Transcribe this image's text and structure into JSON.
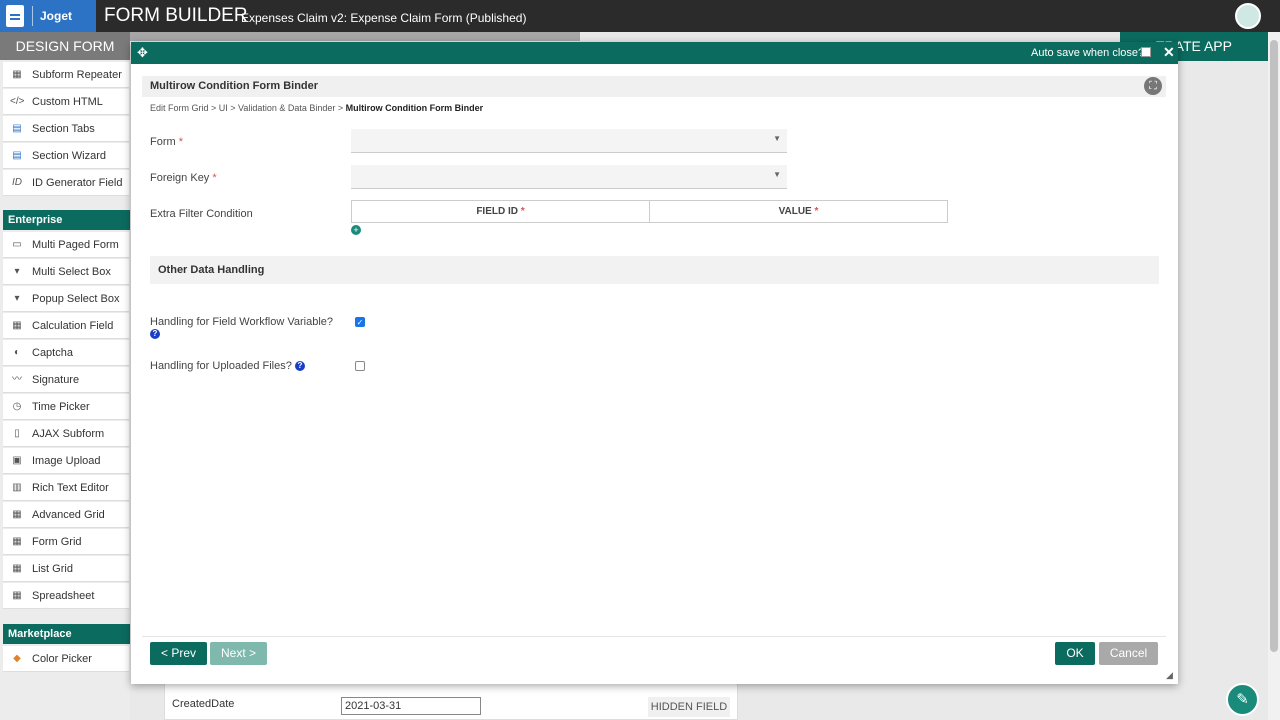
{
  "header": {
    "brand": "Joget",
    "title": "FORM BUILDER",
    "subtitle": "Expenses Claim v2: Expense Claim Form (Published)"
  },
  "tabs": {
    "design_form": "DESIGN FORM",
    "generate_app": "TRATE APP"
  },
  "sidebar": {
    "items_top": [
      {
        "label": "Subform Repeater",
        "icon": "grid-icon"
      },
      {
        "label": "Custom HTML",
        "icon": "code-icon"
      },
      {
        "label": "Section Tabs",
        "icon": "tabs-icon"
      },
      {
        "label": "Section Wizard",
        "icon": "wizard-icon"
      },
      {
        "label": "ID Generator Field",
        "icon": "id-icon"
      }
    ],
    "section_enterprise": "Enterprise",
    "items_enterprise": [
      {
        "label": "Multi Paged Form",
        "icon": "form-icon"
      },
      {
        "label": "Multi Select Box",
        "icon": "select-icon"
      },
      {
        "label": "Popup Select Box",
        "icon": "popup-icon"
      },
      {
        "label": "Calculation Field",
        "icon": "calculator-icon"
      },
      {
        "label": "Captcha",
        "icon": "shield-icon"
      },
      {
        "label": "Signature",
        "icon": "signature-icon"
      },
      {
        "label": "Time Picker",
        "icon": "clock-icon"
      },
      {
        "label": "AJAX Subform",
        "icon": "file-icon"
      },
      {
        "label": "Image Upload",
        "icon": "image-icon"
      },
      {
        "label": "Rich Text Editor",
        "icon": "editor-icon"
      },
      {
        "label": "Advanced Grid",
        "icon": "grid-icon"
      },
      {
        "label": "Form Grid",
        "icon": "grid-icon"
      },
      {
        "label": "List Grid",
        "icon": "grid-icon"
      },
      {
        "label": "Spreadsheet",
        "icon": "grid-icon"
      }
    ],
    "section_marketplace": "Marketplace",
    "items_marketplace": [
      {
        "label": "Color Picker",
        "icon": "layers-icon"
      }
    ]
  },
  "background": {
    "created_label": "CreatedDate",
    "created_value": "2021-03-31",
    "hidden_field": "HIDDEN FIELD"
  },
  "dialog": {
    "autosave_label": "Auto save when close?",
    "autosave_checked": false,
    "panel_title": "Multirow Condition Form Binder",
    "breadcrumb": "Edit Form Grid > UI > Validation & Data Binder > ",
    "breadcrumb_current": "Multirow Condition Form Binder",
    "form_label": "Form",
    "foreign_key_label": "Foreign Key",
    "extra_filter_label": "Extra Filter Condition",
    "grid_columns": [
      "FIELD ID",
      "VALUE"
    ],
    "required_mark": "*",
    "other_section": "Other Data Handling",
    "wf_var_label": "Handling for Field Workflow Variable?",
    "wf_var_checked": true,
    "uploaded_label": "Handling for Uploaded Files?",
    "uploaded_checked": false,
    "buttons": {
      "prev": "< Prev",
      "next": "Next >",
      "ok": "OK",
      "cancel": "Cancel"
    }
  }
}
